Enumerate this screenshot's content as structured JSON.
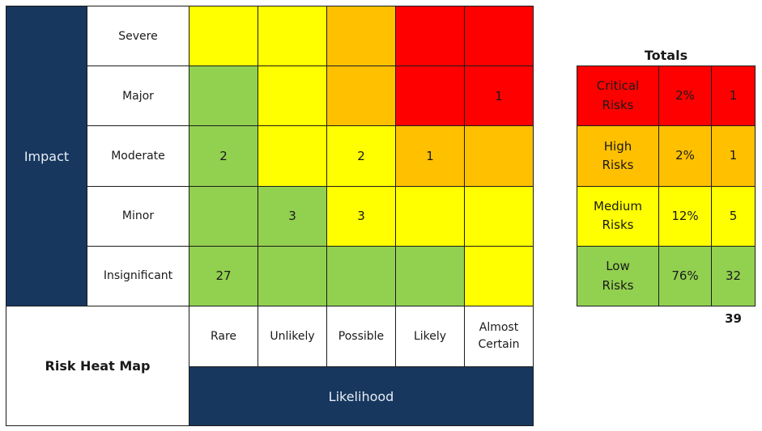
{
  "chart_data": {
    "type": "heatmap",
    "title": "Risk Heat Map",
    "xlabel": "Likelihood",
    "ylabel": "Impact",
    "x_categories": [
      "Rare",
      "Unlikely",
      "Possible",
      "Likely",
      "Almost Certain"
    ],
    "y_categories": [
      "Severe",
      "Major",
      "Moderate",
      "Minor",
      "Insignificant"
    ],
    "colors": {
      "low": "#92d050",
      "medium": "#ffff00",
      "high": "#ffc000",
      "critical": "#ff0000"
    },
    "levels": [
      [
        "medium",
        "medium",
        "high",
        "critical",
        "critical"
      ],
      [
        "low",
        "medium",
        "high",
        "critical",
        "critical"
      ],
      [
        "low",
        "medium",
        "medium",
        "high",
        "high"
      ],
      [
        "low",
        "low",
        "medium",
        "medium",
        "medium"
      ],
      [
        "low",
        "low",
        "low",
        "low",
        "medium"
      ]
    ],
    "values": [
      [
        null,
        null,
        null,
        null,
        null
      ],
      [
        null,
        null,
        null,
        null,
        1
      ],
      [
        2,
        null,
        2,
        1,
        null
      ],
      [
        null,
        3,
        3,
        null,
        null
      ],
      [
        27,
        null,
        null,
        null,
        null
      ]
    ],
    "totals": {
      "title": "Totals",
      "rows": [
        {
          "label": "Critical Risks",
          "percent": "2%",
          "count": "1",
          "level": "critical"
        },
        {
          "label": "High Risks",
          "percent": "2%",
          "count": "1",
          "level": "high"
        },
        {
          "label": "Medium Risks",
          "percent": "12%",
          "count": "5",
          "level": "medium"
        },
        {
          "label": "Low Risks",
          "percent": "76%",
          "count": "32",
          "level": "low"
        }
      ],
      "grand_total": "39"
    }
  }
}
